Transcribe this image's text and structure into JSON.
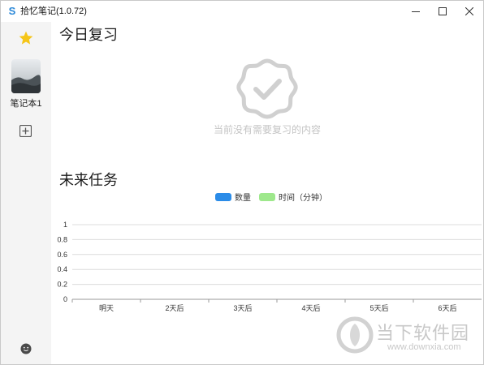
{
  "window": {
    "title": "拾忆笔记(1.0.72)",
    "app_icon_letter": "S"
  },
  "sidebar": {
    "notebook_label": "笔记本1"
  },
  "today": {
    "title": "今日复习",
    "empty_text": "当前没有需要复习的内容"
  },
  "future": {
    "title": "未来任务"
  },
  "chart_data": {
    "type": "bar",
    "categories": [
      "明天",
      "2天后",
      "3天后",
      "4天后",
      "5天后",
      "6天后"
    ],
    "series": [
      {
        "name": "数量",
        "values": [
          0,
          0,
          0,
          0,
          0,
          0
        ],
        "color": "#2b8ce8"
      },
      {
        "name": "时间（分钟）",
        "values": [
          0,
          0,
          0,
          0,
          0,
          0
        ],
        "color": "#9ee88c"
      }
    ],
    "yticks": [
      "1",
      "0.8",
      "0.6",
      "0.4",
      "0.2",
      "0"
    ],
    "ylim": [
      0,
      1
    ],
    "grid": true,
    "legend_position": "top-center"
  },
  "watermark": {
    "text": "当下软件园",
    "url": "www.downxia.com"
  },
  "colors": {
    "star": "#f5c518",
    "empty_icon": "#d0d0d0",
    "sidebar_bg": "#f4f4f4"
  }
}
